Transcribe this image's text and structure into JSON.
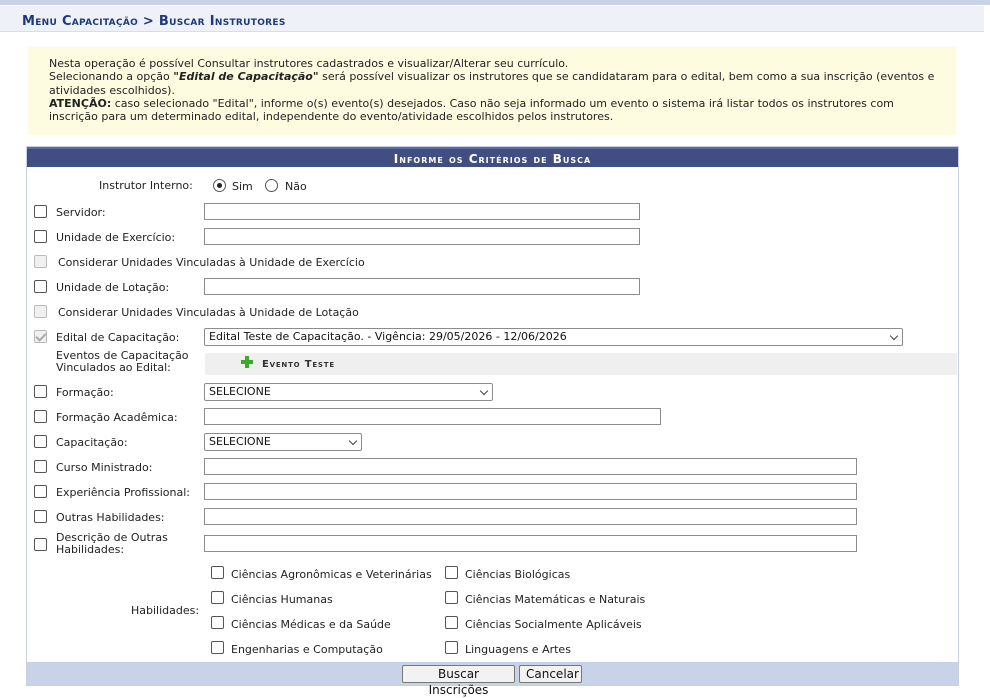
{
  "breadcrumb": "Menu Capacitação > Buscar Instrutores",
  "info": {
    "line1": "Nesta operação é possível Consultar instrutores cadastrados e visualizar/Alterar seu currículo.",
    "line2_pre": "Selecionando a opção ",
    "line2_emph": "\"Edital de Capacitação\"",
    "line2_post": " será possível visualizar os instrutores que se candidataram para o edital, bem como a sua inscrição (eventos e atividades escolhidos).",
    "line3_strong": "ATENÇÃO:",
    "line3_post": " caso selecionado \"Edital\", informe o(s) evento(s) desejados. Caso não seja informado um evento o sistema irá listar todos os instrutores com inscrição para um determinado edital, independente do evento/atividade escolhidos pelos instrutores."
  },
  "form": {
    "header": "Informe os Critérios de Busca",
    "instrutor_interno": {
      "label": "Instrutor Interno:",
      "option_yes": "Sim",
      "option_no": "Não",
      "selected": "Sim"
    },
    "servidor": "Servidor:",
    "unidade_exercicio": "Unidade de Exercício:",
    "considerar_exercicio": "Considerar Unidades Vinculadas à Unidade de Exercício",
    "unidade_lotacao": "Unidade de Lotação:",
    "considerar_lotacao": "Considerar Unidades Vinculadas à Unidade de Lotação",
    "edital": {
      "label": "Edital de Capacitação:",
      "value": "Edital Teste de Capacitação. - Vigência: 29/05/2026 - 12/06/2026"
    },
    "eventos": {
      "label": "Eventos de Capacitação Vinculados ao Edital:",
      "item": "Evento Teste"
    },
    "formacao": {
      "label": "Formação:",
      "value": "SELECIONE"
    },
    "formacao_academica": "Formação Acadêmica:",
    "capacitacao": {
      "label": "Capacitação:",
      "value": "SELECIONE"
    },
    "curso_ministrado": "Curso Ministrado:",
    "experiencia": "Experiência Profissional:",
    "outras_habilidades": "Outras Habilidades:",
    "descricao_outras": "Descrição de Outras Habilidades:",
    "habilidades": {
      "label": "Habilidades:",
      "items": [
        "Ciências Agronômicas e Veterinárias",
        "Ciências Biológicas",
        "Ciências Humanas",
        "Ciências Matemáticas e Naturais",
        "Ciências Médicas e da Saúde",
        "Ciências Socialmente Aplicáveis",
        "Engenharias e Computação",
        "Linguagens e Artes"
      ]
    },
    "buttons": {
      "buscar": "Buscar Inscrições",
      "cancelar": "Cancelar"
    }
  }
}
